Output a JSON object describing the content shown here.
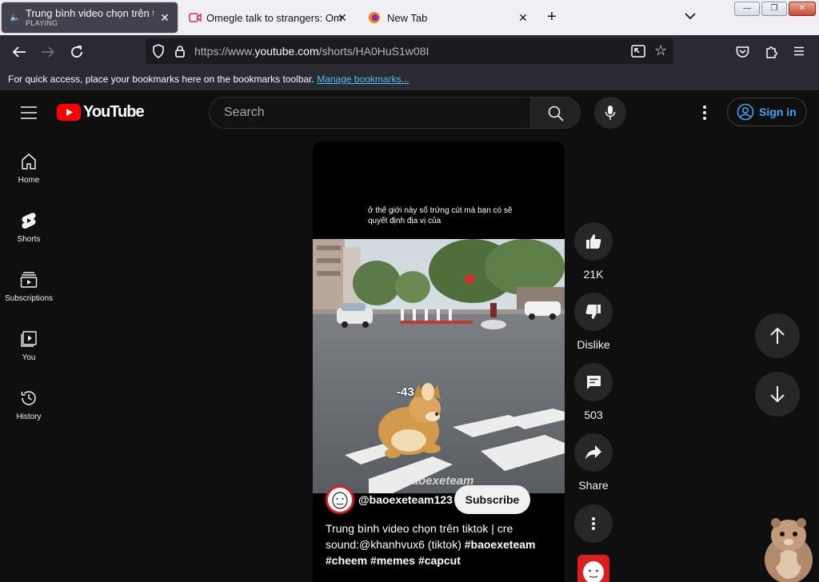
{
  "browser": {
    "tabs": [
      {
        "title": "Trung bình video chọn trên tik",
        "status": "PLAYING",
        "icon": "speaker-icon"
      },
      {
        "title": "Omegle talk to strangers: Omeg",
        "icon": "omegle-video-icon"
      },
      {
        "title": "New Tab",
        "icon": "firefox-icon"
      }
    ],
    "url_prefix": "https://www.",
    "url_host": "youtube.com",
    "url_path": "/shorts/HA0HuS1w08I",
    "bookmarks_message": "For quick access, place your bookmarks here on the bookmarks toolbar.",
    "manage_bookmarks": "Manage bookmarks..."
  },
  "youtube": {
    "logo_text": "YouTube",
    "search_placeholder": "Search",
    "sign_in": "Sign in",
    "sidebar": [
      {
        "label": "Home",
        "icon": "home-icon"
      },
      {
        "label": "Shorts",
        "icon": "shorts-icon"
      },
      {
        "label": "Subscriptions",
        "icon": "subscriptions-icon"
      },
      {
        "label": "You",
        "icon": "you-icon"
      },
      {
        "label": "History",
        "icon": "history-icon"
      }
    ],
    "short": {
      "overlay_caption_line1": "ở thế giới này số trứng cút mà bạn có sẽ",
      "overlay_caption_line2": "quyết định địa vị của",
      "score_overlay": "-43",
      "watermark": "Baoexeteam",
      "channel": "@baoexeteam123",
      "subscribe": "Subscribe",
      "desc_line1": "Trung bình video chọn trên tiktok | cre",
      "desc_line2": "sound:@khanhvux6 (tiktok)",
      "tags_line2": "#baoexeteam",
      "tags_line3": [
        "#cheem",
        "#memes",
        "#capcut"
      ]
    },
    "actions": {
      "likes": "21K",
      "dislike": "Dislike",
      "comments": "503",
      "share": "Share"
    }
  },
  "colors": {
    "yt_red": "#ff0000",
    "yt_bg": "#0f0f0f",
    "signin_blue": "#3ea6ff",
    "firefox_toolbar": "#2b2a33"
  }
}
